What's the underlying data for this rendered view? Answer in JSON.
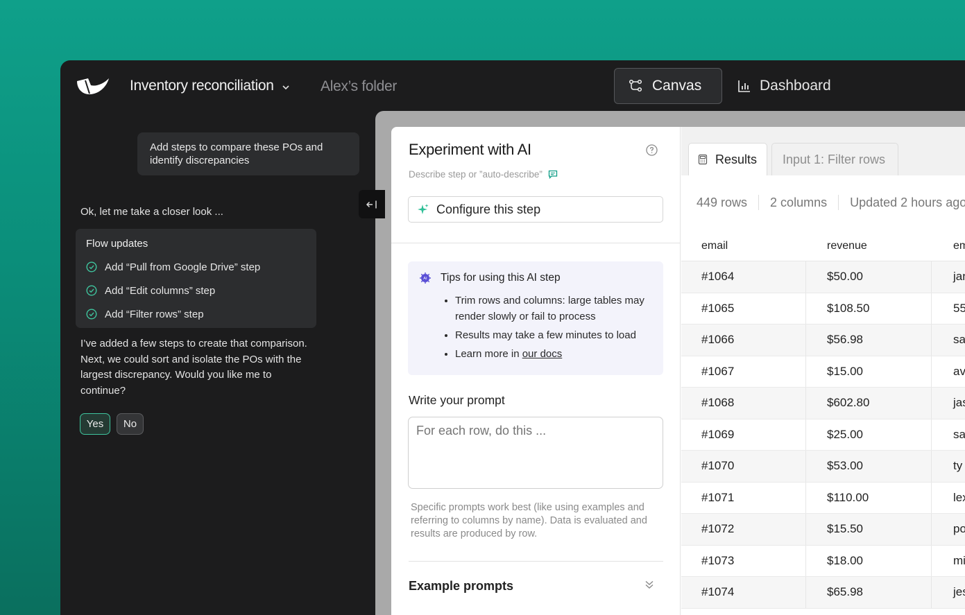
{
  "header": {
    "project_title": "Inventory reconciliation",
    "folder": "Alex’s folder",
    "nav_canvas": "Canvas",
    "nav_dashboard": "Dashboard"
  },
  "chat": {
    "user_message": "Add steps to compare these POs and identify discrepancies",
    "ai_intro": "Ok, let me take a closer look ...",
    "flow_title": "Flow updates",
    "flow_items": [
      "Add “Pull from Google Drive” step",
      "Add “Edit columns” step",
      "Add “Filter rows” step"
    ],
    "ai_followup": "I’ve added a few steps to create that comparison. Next, we could sort and isolate the POs with the largest discrepancy. Would you like me to continue?",
    "yes_label": "Yes",
    "no_label": "No"
  },
  "step_panel": {
    "title": "Experiment with AI",
    "describe_hint": "Describe step or ”auto-describe”",
    "configure_label": "Configure this step",
    "tips_title": "Tips for using this AI step",
    "tips": [
      "Trim rows and columns: large tables may render slowly or fail to process",
      "Results may take a few minutes to load"
    ],
    "tip_learn_prefix": "Learn more in ",
    "tip_learn_link": "our docs",
    "prompt_label": "Write your prompt",
    "prompt_placeholder": "For each row, do this ...",
    "prompt_hint": "Specific prompts work best (like using examples and referring to columns by name). Data is evaluated and results are produced by row.",
    "example_prompts": "Example prompts"
  },
  "results": {
    "tab_results": "Results",
    "tab_input": "Input 1: Filter rows",
    "rows": "449 rows",
    "columns": "2 columns",
    "updated": "Updated 2 hours ago",
    "headers": [
      "email",
      "revenue",
      "em"
    ],
    "data": [
      [
        "#1064",
        "$50.00",
        "jan"
      ],
      [
        "#1065",
        "$108.50",
        "55"
      ],
      [
        "#1066",
        "$56.98",
        "sa"
      ],
      [
        "#1067",
        "$15.00",
        "av"
      ],
      [
        "#1068",
        "$602.80",
        "jas"
      ],
      [
        "#1069",
        "$25.00",
        "sa"
      ],
      [
        "#1070",
        "$53.00",
        "ty"
      ],
      [
        "#1071",
        "$110.00",
        "lex"
      ],
      [
        "#1072",
        "$15.50",
        "po"
      ],
      [
        "#1073",
        "$18.00",
        "mi"
      ],
      [
        "#1074",
        "$65.98",
        "jes"
      ]
    ]
  },
  "colors": {
    "background_teal": "#0fa08a",
    "app_dark": "#1c1c1d",
    "accent_green": "#3fc59e"
  }
}
